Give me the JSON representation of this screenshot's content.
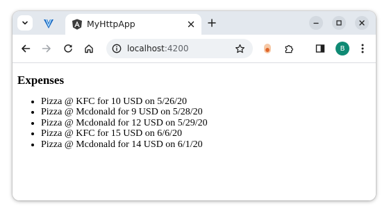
{
  "browser": {
    "tab": {
      "title": "MyHttpApp",
      "favicon": "angular-icon"
    },
    "address_bar": {
      "host": "localhost",
      "port": ":4200"
    },
    "profile": {
      "initial": "B",
      "color": "#0f8a74"
    }
  },
  "page": {
    "heading": "Expenses",
    "items": [
      "Pizza @ KFC for 10 USD on 5/26/20",
      "Pizza @ Mcdonald for 9 USD on 5/28/20",
      "Pizza @ Mcdonald for 12 USD on 5/29/20",
      "Pizza @ KFC for 15 USD on 6/6/20",
      "Pizza @ Mcdonald for 14 USD on 6/1/20"
    ]
  }
}
